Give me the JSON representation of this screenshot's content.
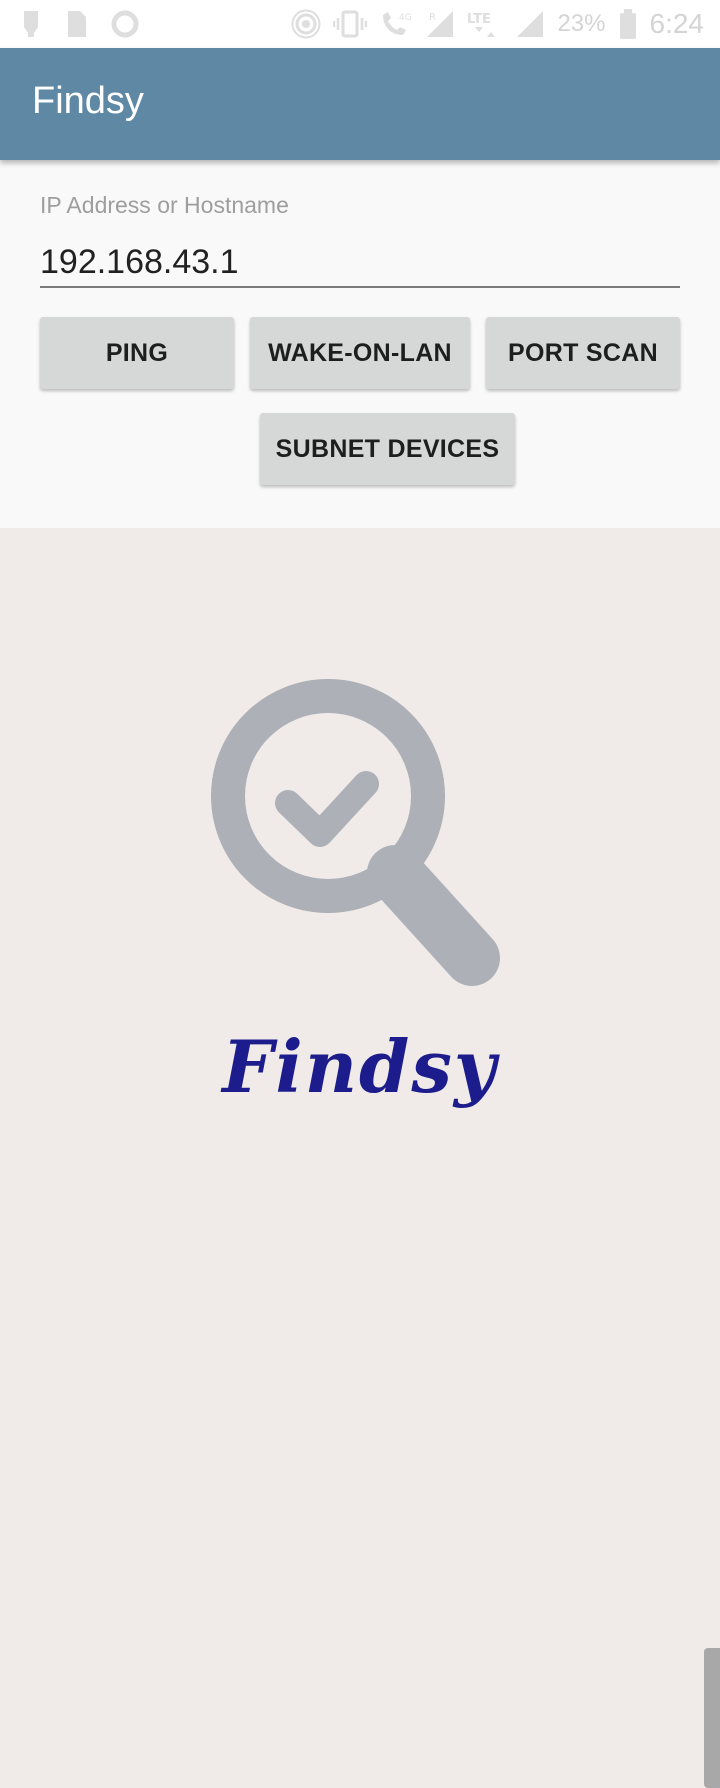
{
  "status_bar": {
    "battery_percent": "23%",
    "time": "6:24",
    "left_icons": [
      "usb-icon",
      "sim-card-icon",
      "sync-circle-icon"
    ],
    "right_icons": [
      "hotspot-icon",
      "vibrate-icon",
      "volte-call-icon",
      "signal-r-icon",
      "lte-icon",
      "signal-icon",
      "battery-icon"
    ]
  },
  "app_bar": {
    "title": "Findsy"
  },
  "form": {
    "input_label": "IP Address or Hostname",
    "ip_value": "192.168.43.1",
    "buttons": {
      "ping": "PING",
      "wake_on_lan": "WAKE-ON-LAN",
      "port_scan": "PORT SCAN",
      "subnet_devices": "SUBNET DEVICES"
    }
  },
  "logo": {
    "icon": "magnifier-check-icon",
    "brand_text": "Findsy",
    "icon_color": "#adb0b7",
    "brand_color": "#1c1c8c"
  },
  "colors": {
    "app_bar": "#5f88a5",
    "form_background": "#f9f9f9",
    "page_background": "#f0ebe8",
    "button_background": "#d6d7d7"
  }
}
